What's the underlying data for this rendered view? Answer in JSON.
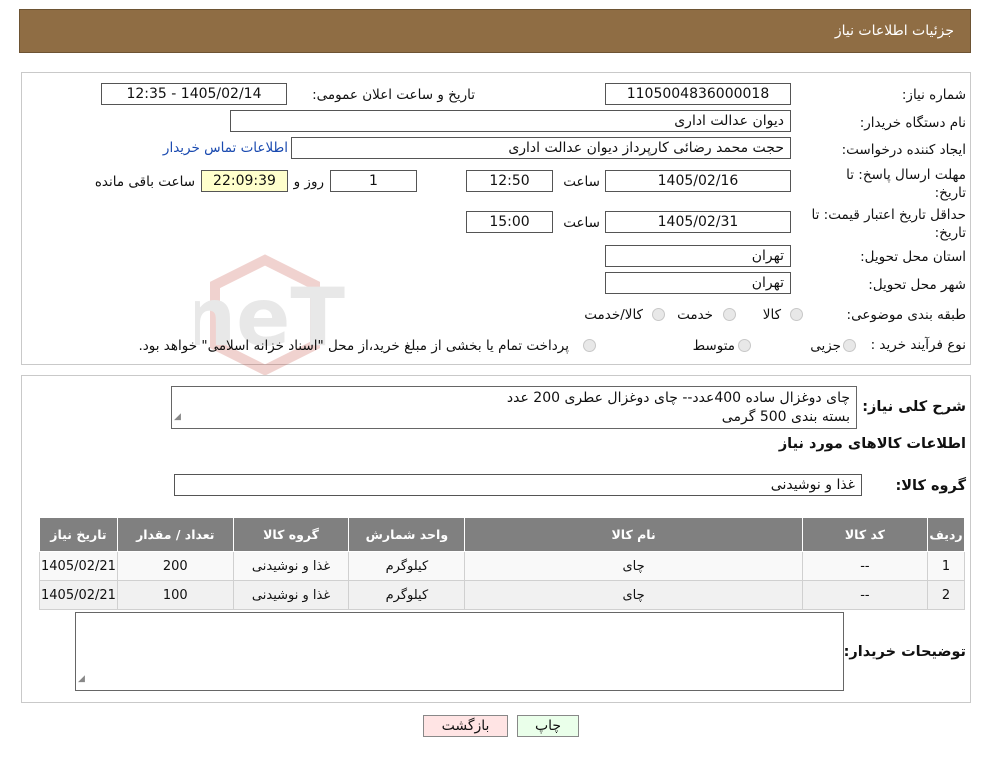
{
  "header": {
    "title": "جزئیات اطلاعات نیاز"
  },
  "form": {
    "need_number_label": "شماره نیاز:",
    "need_number": "1105004836000018",
    "announce_label": "تاریخ و ساعت اعلان عمومی:",
    "announce_value": "1405/02/14 - 12:35",
    "buyer_label": "نام دستگاه خریدار:",
    "buyer_value": "دیوان عدالت اداری",
    "creator_label": "ایجاد کننده درخواست:",
    "creator_value": "حجت محمد رضائی کارپرداز دیوان عدالت اداری",
    "contact_link": "اطلاعات تماس خریدار",
    "deadline_label": "مهلت ارسال پاسخ: تا تاریخ:",
    "deadline_date": "1405/02/16",
    "time_label": "ساعت",
    "deadline_time": "12:50",
    "days_value": "1",
    "days_label": "روز و",
    "remaining_time": "22:09:39",
    "remaining_label": "ساعت باقی مانده",
    "validity_label": "حداقل تاریخ اعتبار قیمت: تا تاریخ:",
    "validity_date": "1405/02/31",
    "validity_time": "15:00",
    "province_label": "استان محل تحویل:",
    "province_value": "تهران",
    "city_label": "شهر محل تحویل:",
    "city_value": "تهران",
    "category_label": "طبقه بندی موضوعی:",
    "category_options": [
      "کالا",
      "خدمت",
      "کالا/خدمت"
    ],
    "process_label": "نوع فرآیند خرید :",
    "process_options": [
      "جزیی",
      "متوسط"
    ],
    "process_note": "پرداخت تمام یا بخشی از مبلغ خرید،از محل \"اسناد خزانه اسلامی\" خواهد بود."
  },
  "description": {
    "label": "شرح کلی نیاز:",
    "line1": "چای دوغزال ساده 400عدد-- چای دوغزال عطری 200 عدد",
    "line2": "بسته بندی 500 گرمی"
  },
  "goods": {
    "section_title": "اطلاعات کالاهای مورد نیاز",
    "group_label": "گروه کالا:",
    "group_value": "غذا و نوشیدنی",
    "columns": [
      "ردیف",
      "کد کالا",
      "نام کالا",
      "واحد شمارش",
      "گروه کالا",
      "تعداد / مقدار",
      "تاریخ نیاز"
    ],
    "rows": [
      [
        "1",
        "--",
        "چای",
        "کیلوگرم",
        "غذا و نوشیدنی",
        "200",
        "1405/02/21"
      ],
      [
        "2",
        "--",
        "چای",
        "کیلوگرم",
        "غذا و نوشیدنی",
        "100",
        "1405/02/21"
      ]
    ]
  },
  "notes": {
    "label": "توضیحات خریدار:",
    "value": ""
  },
  "buttons": {
    "print": "چاپ",
    "back": "بازگشت"
  },
  "colors": {
    "header_bg": "#8f6d44",
    "table_header_bg": "#808080",
    "print_bg": "#eaffea",
    "back_bg": "#ffe4e4"
  }
}
